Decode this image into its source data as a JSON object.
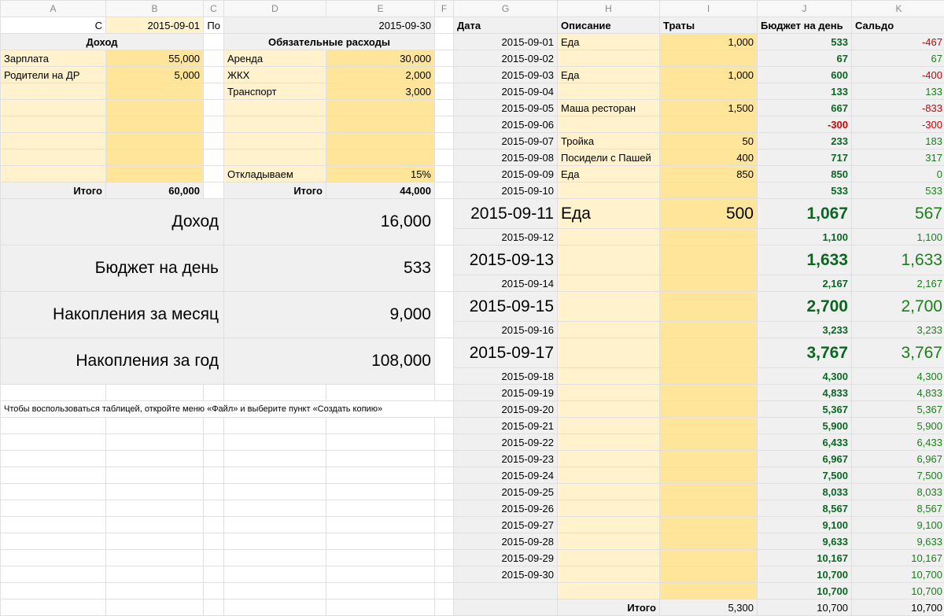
{
  "cols": [
    "A",
    "B",
    "C",
    "D",
    "E",
    "F",
    "G",
    "H",
    "I",
    "J",
    "K"
  ],
  "period": {
    "from_label": "С",
    "from": "2015-09-01",
    "to_label": "По",
    "to": "2015-09-30"
  },
  "headers_right": {
    "date": "Дата",
    "desc": "Описание",
    "spend": "Траты",
    "budget": "Бюджет на день",
    "balance": "Сальдо"
  },
  "income_header": "Доход",
  "expense_header": "Обязательные расходы",
  "income_rows": [
    {
      "name": "Зарплата",
      "amount": "55,000"
    },
    {
      "name": "Родители на ДР",
      "amount": "5,000"
    },
    {
      "name": "",
      "amount": ""
    },
    {
      "name": "",
      "amount": ""
    },
    {
      "name": "",
      "amount": ""
    },
    {
      "name": "",
      "amount": ""
    },
    {
      "name": "",
      "amount": ""
    },
    {
      "name": "",
      "amount": ""
    }
  ],
  "expense_rows": [
    {
      "name": "Аренда",
      "amount": "30,000"
    },
    {
      "name": "ЖКХ",
      "amount": "2,000"
    },
    {
      "name": "Транспорт",
      "amount": "3,000"
    },
    {
      "name": "",
      "amount": ""
    },
    {
      "name": "",
      "amount": ""
    },
    {
      "name": "",
      "amount": ""
    },
    {
      "name": "",
      "amount": ""
    },
    {
      "name": "Откладываем",
      "amount": "15%"
    }
  ],
  "itogo": "Итого",
  "income_total": "60,000",
  "expense_total": "44,000",
  "summary": [
    {
      "label": "Доход",
      "value": "16,000"
    },
    {
      "label": "Бюджет на день",
      "value": "533"
    },
    {
      "label": "Накопления за месяц",
      "value": "9,000"
    },
    {
      "label": "Накопления за год",
      "value": "108,000"
    }
  ],
  "note": "Чтобы воспользоваться таблицей, откройте меню «Файл» и выберите пункт «Создать копию»",
  "daily": [
    {
      "date": "2015-09-01",
      "desc": "Еда",
      "spend": "1,000",
      "budget": "533",
      "budget_neg": false,
      "balance": "-467",
      "bal_neg": true
    },
    {
      "date": "2015-09-02",
      "desc": "",
      "spend": "",
      "budget": "67",
      "budget_neg": false,
      "balance": "67",
      "bal_neg": false
    },
    {
      "date": "2015-09-03",
      "desc": "Еда",
      "spend": "1,000",
      "budget": "600",
      "budget_neg": false,
      "balance": "-400",
      "bal_neg": true
    },
    {
      "date": "2015-09-04",
      "desc": "",
      "spend": "",
      "budget": "133",
      "budget_neg": false,
      "balance": "133",
      "bal_neg": false
    },
    {
      "date": "2015-09-05",
      "desc": "Маша ресторан",
      "spend": "1,500",
      "budget": "667",
      "budget_neg": false,
      "balance": "-833",
      "bal_neg": true
    },
    {
      "date": "2015-09-06",
      "desc": "",
      "spend": "",
      "budget": "-300",
      "budget_neg": true,
      "balance": "-300",
      "bal_neg": true
    },
    {
      "date": "2015-09-07",
      "desc": "Тройка",
      "spend": "50",
      "budget": "233",
      "budget_neg": false,
      "balance": "183",
      "bal_neg": false
    },
    {
      "date": "2015-09-08",
      "desc": "Посидели с Пашей",
      "spend": "400",
      "budget": "717",
      "budget_neg": false,
      "balance": "317",
      "bal_neg": false
    },
    {
      "date": "2015-09-09",
      "desc": "Еда",
      "spend": "850",
      "budget": "850",
      "budget_neg": false,
      "balance": "0",
      "bal_neg": false
    },
    {
      "date": "2015-09-10",
      "desc": "",
      "spend": "",
      "budget": "533",
      "budget_neg": false,
      "balance": "533",
      "bal_neg": false
    },
    {
      "date": "2015-09-11",
      "desc": "Еда",
      "spend": "500",
      "budget": "1,067",
      "budget_neg": false,
      "balance": "567",
      "bal_neg": false
    },
    {
      "date": "2015-09-12",
      "desc": "",
      "spend": "",
      "budget": "1,100",
      "budget_neg": false,
      "balance": "1,100",
      "bal_neg": false
    },
    {
      "date": "2015-09-13",
      "desc": "",
      "spend": "",
      "budget": "1,633",
      "budget_neg": false,
      "balance": "1,633",
      "bal_neg": false
    },
    {
      "date": "2015-09-14",
      "desc": "",
      "spend": "",
      "budget": "2,167",
      "budget_neg": false,
      "balance": "2,167",
      "bal_neg": false
    },
    {
      "date": "2015-09-15",
      "desc": "",
      "spend": "",
      "budget": "2,700",
      "budget_neg": false,
      "balance": "2,700",
      "bal_neg": false
    },
    {
      "date": "2015-09-16",
      "desc": "",
      "spend": "",
      "budget": "3,233",
      "budget_neg": false,
      "balance": "3,233",
      "bal_neg": false
    },
    {
      "date": "2015-09-17",
      "desc": "",
      "spend": "",
      "budget": "3,767",
      "budget_neg": false,
      "balance": "3,767",
      "bal_neg": false
    },
    {
      "date": "2015-09-18",
      "desc": "",
      "spend": "",
      "budget": "4,300",
      "budget_neg": false,
      "balance": "4,300",
      "bal_neg": false
    },
    {
      "date": "2015-09-19",
      "desc": "",
      "spend": "",
      "budget": "4,833",
      "budget_neg": false,
      "balance": "4,833",
      "bal_neg": false
    },
    {
      "date": "2015-09-20",
      "desc": "",
      "spend": "",
      "budget": "5,367",
      "budget_neg": false,
      "balance": "5,367",
      "bal_neg": false
    },
    {
      "date": "2015-09-21",
      "desc": "",
      "spend": "",
      "budget": "5,900",
      "budget_neg": false,
      "balance": "5,900",
      "bal_neg": false
    },
    {
      "date": "2015-09-22",
      "desc": "",
      "spend": "",
      "budget": "6,433",
      "budget_neg": false,
      "balance": "6,433",
      "bal_neg": false
    },
    {
      "date": "2015-09-23",
      "desc": "",
      "spend": "",
      "budget": "6,967",
      "budget_neg": false,
      "balance": "6,967",
      "bal_neg": false
    },
    {
      "date": "2015-09-24",
      "desc": "",
      "spend": "",
      "budget": "7,500",
      "budget_neg": false,
      "balance": "7,500",
      "bal_neg": false
    },
    {
      "date": "2015-09-25",
      "desc": "",
      "spend": "",
      "budget": "8,033",
      "budget_neg": false,
      "balance": "8,033",
      "bal_neg": false
    },
    {
      "date": "2015-09-26",
      "desc": "",
      "spend": "",
      "budget": "8,567",
      "budget_neg": false,
      "balance": "8,567",
      "bal_neg": false
    },
    {
      "date": "2015-09-27",
      "desc": "",
      "spend": "",
      "budget": "9,100",
      "budget_neg": false,
      "balance": "9,100",
      "bal_neg": false
    },
    {
      "date": "2015-09-28",
      "desc": "",
      "spend": "",
      "budget": "9,633",
      "budget_neg": false,
      "balance": "9,633",
      "bal_neg": false
    },
    {
      "date": "2015-09-29",
      "desc": "",
      "spend": "",
      "budget": "10,167",
      "budget_neg": false,
      "balance": "10,167",
      "bal_neg": false
    },
    {
      "date": "2015-09-30",
      "desc": "",
      "spend": "",
      "budget": "10,700",
      "budget_neg": false,
      "balance": "10,700",
      "bal_neg": false
    },
    {
      "date": "",
      "desc": "",
      "spend": "",
      "budget": "10,700",
      "budget_neg": false,
      "balance": "10,700",
      "bal_neg": false
    }
  ],
  "daily_total": {
    "label": "Итого",
    "spend": "5,300",
    "budget": "10,700",
    "balance": "10,700"
  }
}
